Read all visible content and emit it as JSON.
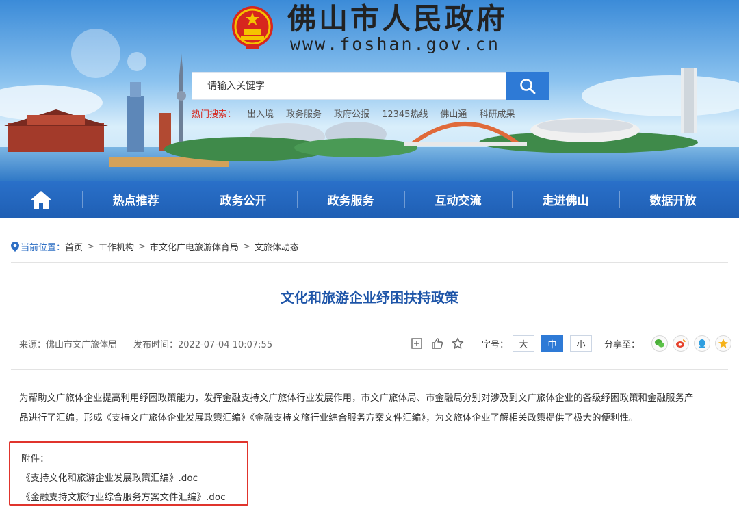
{
  "header": {
    "title": "佛山市人民政府",
    "url": "www.foshan.gov.cn",
    "emblem_icon": "national-emblem-icon",
    "search": {
      "placeholder": "请输入关键字",
      "button_icon": "search-icon"
    },
    "hot_search": {
      "label": "热门搜索：",
      "items": [
        "出入境",
        "政务服务",
        "政府公报",
        "12345热线",
        "佛山通",
        "科研成果"
      ]
    }
  },
  "nav": {
    "home_icon": "home-icon",
    "items": [
      "热点推荐",
      "政务公开",
      "政务服务",
      "互动交流",
      "走进佛山",
      "数据开放"
    ]
  },
  "breadcrumb": {
    "icon": "location-pin-icon",
    "label": "当前位置：",
    "items": [
      "首页",
      "工作机构",
      "市文化广电旅游体育局",
      "文旅体动态"
    ],
    "separator": ">"
  },
  "article": {
    "title": "文化和旅游企业纾困扶持政策",
    "source": "来源：佛山市文广旅体局",
    "publish_time": "发布时间：2022-07-04 10:07:55",
    "tools": {
      "font_label": "字号：",
      "sizes": [
        "大",
        "中",
        "小"
      ],
      "active_size": "中",
      "share_label": "分享至："
    },
    "body_line_1": "为帮助文广旅体企业提高利用纾困政策能力，发挥金融支持文广旅体行业发展作用，市文广旅体局、市金融局分别对涉及到文广旅体企业的各级纾困政策和金融服务产",
    "body_line_2": "品进行了汇编，形成《支持文广旅体企业发展政策汇编》《金融支持文旅行业综合服务方案文件汇编》，为文旅体企业了解相关政策提供了极大的便利性。",
    "attachments": {
      "label": "附件：",
      "files": [
        "《支持文化和旅游企业发展政策汇编》.doc",
        "《金融支持文旅行业综合服务方案文件汇编》.doc"
      ]
    }
  },
  "colors": {
    "nav_blue": "#2a70c9",
    "title_blue": "#1e55a8",
    "hot_red": "#d6261c",
    "attach_border": "#e0342c",
    "active_size": "#2e7ad6"
  }
}
